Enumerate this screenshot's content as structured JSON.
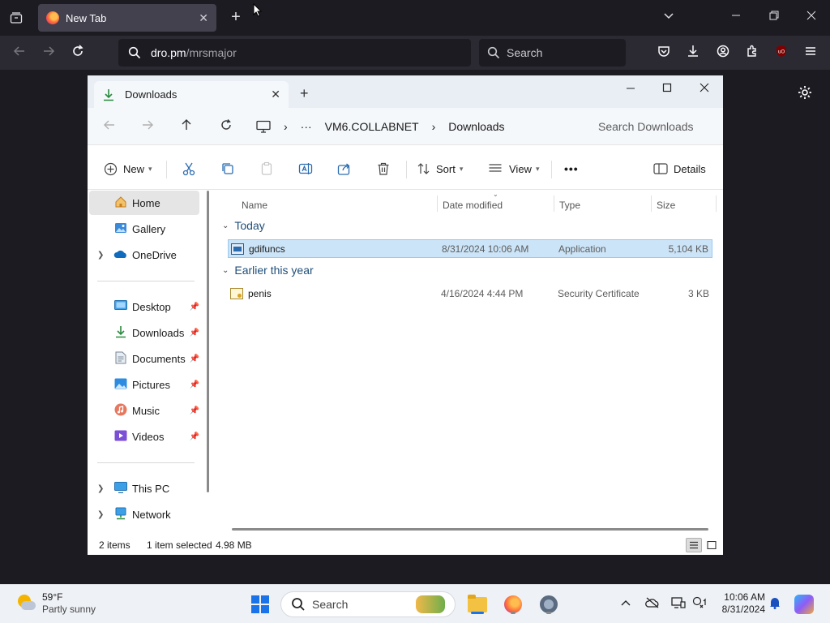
{
  "browser": {
    "tab_title": "New Tab",
    "url_domain": "dro.pm",
    "url_path": "/mrsmajor",
    "search_placeholder": "Search"
  },
  "explorer": {
    "tab_title": "Downloads",
    "breadcrumbs": [
      "VM6.COLLABNET",
      "Downloads"
    ],
    "search_placeholder": "Search Downloads",
    "toolbar": {
      "new_label": "New",
      "sort_label": "Sort",
      "view_label": "View",
      "more_label": "•••",
      "details_label": "Details"
    },
    "sidebar": {
      "items": [
        {
          "label": "Home",
          "icon": "home-icon",
          "selected": true
        },
        {
          "label": "Gallery",
          "icon": "gallery-icon"
        },
        {
          "label": "OneDrive",
          "icon": "onedrive-icon",
          "expandable": true
        },
        {
          "label": "Desktop",
          "icon": "desktop-icon",
          "pinned": true
        },
        {
          "label": "Downloads",
          "icon": "download-icon",
          "pinned": true
        },
        {
          "label": "Documents",
          "icon": "documents-icon",
          "pinned": true
        },
        {
          "label": "Pictures",
          "icon": "pictures-icon",
          "pinned": true
        },
        {
          "label": "Music",
          "icon": "music-icon",
          "pinned": true
        },
        {
          "label": "Videos",
          "icon": "videos-icon",
          "pinned": true
        },
        {
          "label": "This PC",
          "icon": "this-pc-icon",
          "expandable": true
        },
        {
          "label": "Network",
          "icon": "network-icon",
          "expandable": true
        }
      ]
    },
    "columns": [
      "Name",
      "Date modified",
      "Type",
      "Size"
    ],
    "groups": [
      {
        "label": "Today",
        "files": [
          {
            "name": "gdifuncs",
            "date": "8/31/2024 10:06 AM",
            "type": "Application",
            "size": "5,104 KB",
            "selected": true
          }
        ]
      },
      {
        "label": "Earlier this year",
        "files": [
          {
            "name": "penis",
            "date": "4/16/2024 4:44 PM",
            "type": "Security Certificate",
            "size": "3 KB"
          }
        ]
      }
    ],
    "status": {
      "items_count": "2 items",
      "selection": "1 item selected",
      "selection_size": "4.98 MB"
    }
  },
  "taskbar": {
    "weather_temp": "59°F",
    "weather_desc": "Partly sunny",
    "search_label": "Search",
    "time": "10:06 AM",
    "date": "8/31/2024"
  }
}
